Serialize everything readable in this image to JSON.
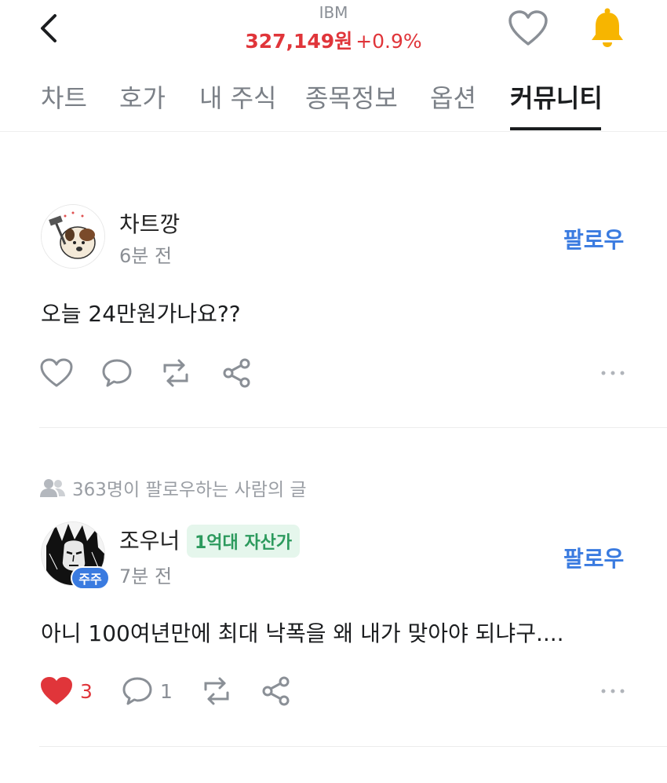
{
  "header": {
    "ticker": "IBM",
    "price": "327,149원",
    "change": "+0.9%"
  },
  "tabs": [
    "차트",
    "호가",
    "내 주식",
    "종목정보",
    "옵션",
    "커뮤니티"
  ],
  "active_tab": "커뮤니티",
  "posts": [
    {
      "username": "차트깡",
      "time": "6분 전",
      "follow_label": "팔로우",
      "content": "오늘 24만원가나요??"
    },
    {
      "context": "363명이 팔로우하는 사람의 글",
      "username": "조우너",
      "badge": "1억대 자산가",
      "holder_badge": "주주",
      "time": "7분 전",
      "follow_label": "팔로우",
      "content": "아니 100여년만에 최대 낙폭을 왜 내가 맞아야 되냐구....",
      "like_count": "3",
      "comment_count": "1",
      "liked": true
    }
  ],
  "colors": {
    "price": "#e0353a",
    "follow": "#3a7be0",
    "like_active": "#e0353a",
    "badge_text": "#2c9a5d",
    "bell": "#f7b500"
  },
  "icons": [
    "back-chevron-icon",
    "heart-outline-icon",
    "bell-icon",
    "heart-icon",
    "comment-icon",
    "repost-icon",
    "share-icon",
    "more-icon",
    "people-icon"
  ]
}
